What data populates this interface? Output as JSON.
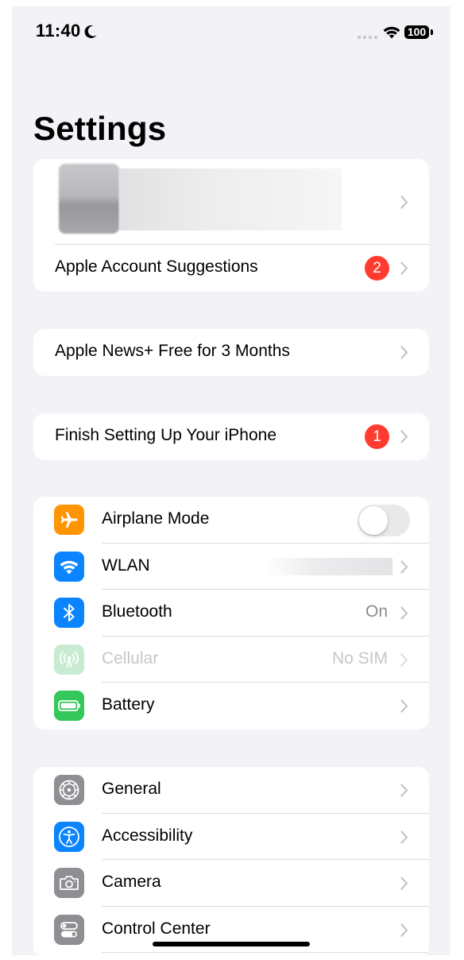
{
  "status_bar": {
    "time": "11:40",
    "battery": "100"
  },
  "title": "Settings",
  "account_group": {
    "suggestions_label": "Apple Account Suggestions",
    "suggestions_badge": "2"
  },
  "news_label": "Apple News+ Free for 3 Months",
  "finish_setup": {
    "label": "Finish Setting Up Your iPhone",
    "badge": "1"
  },
  "connectivity": {
    "airplane": {
      "label": "Airplane Mode",
      "toggle_on": false
    },
    "wlan": {
      "label": "WLAN"
    },
    "bluetooth": {
      "label": "Bluetooth",
      "value": "On"
    },
    "cellular": {
      "label": "Cellular",
      "value": "No SIM"
    },
    "battery": {
      "label": "Battery"
    }
  },
  "system": {
    "general": {
      "label": "General"
    },
    "accessibility": {
      "label": "Accessibility"
    },
    "camera": {
      "label": "Camera"
    },
    "control_center": {
      "label": "Control Center"
    }
  },
  "colors": {
    "airplane": "#ff9500",
    "wlan": "#0a84ff",
    "bluetooth": "#0a84ff",
    "cellular": "#c7ecd2",
    "battery": "#34c759",
    "general": "#8e8e93",
    "accessibility": "#0a84ff",
    "camera": "#8e8e93",
    "control_center": "#8e8e93",
    "badge": "#ff3b30"
  },
  "icons": {
    "airplane": "airplane-icon",
    "wlan": "wifi-icon",
    "bluetooth": "bluetooth-icon",
    "cellular": "antenna-icon",
    "battery": "battery-icon",
    "general": "gear-icon",
    "accessibility": "accessibility-icon",
    "camera": "camera-icon",
    "control_center": "toggles-icon"
  }
}
